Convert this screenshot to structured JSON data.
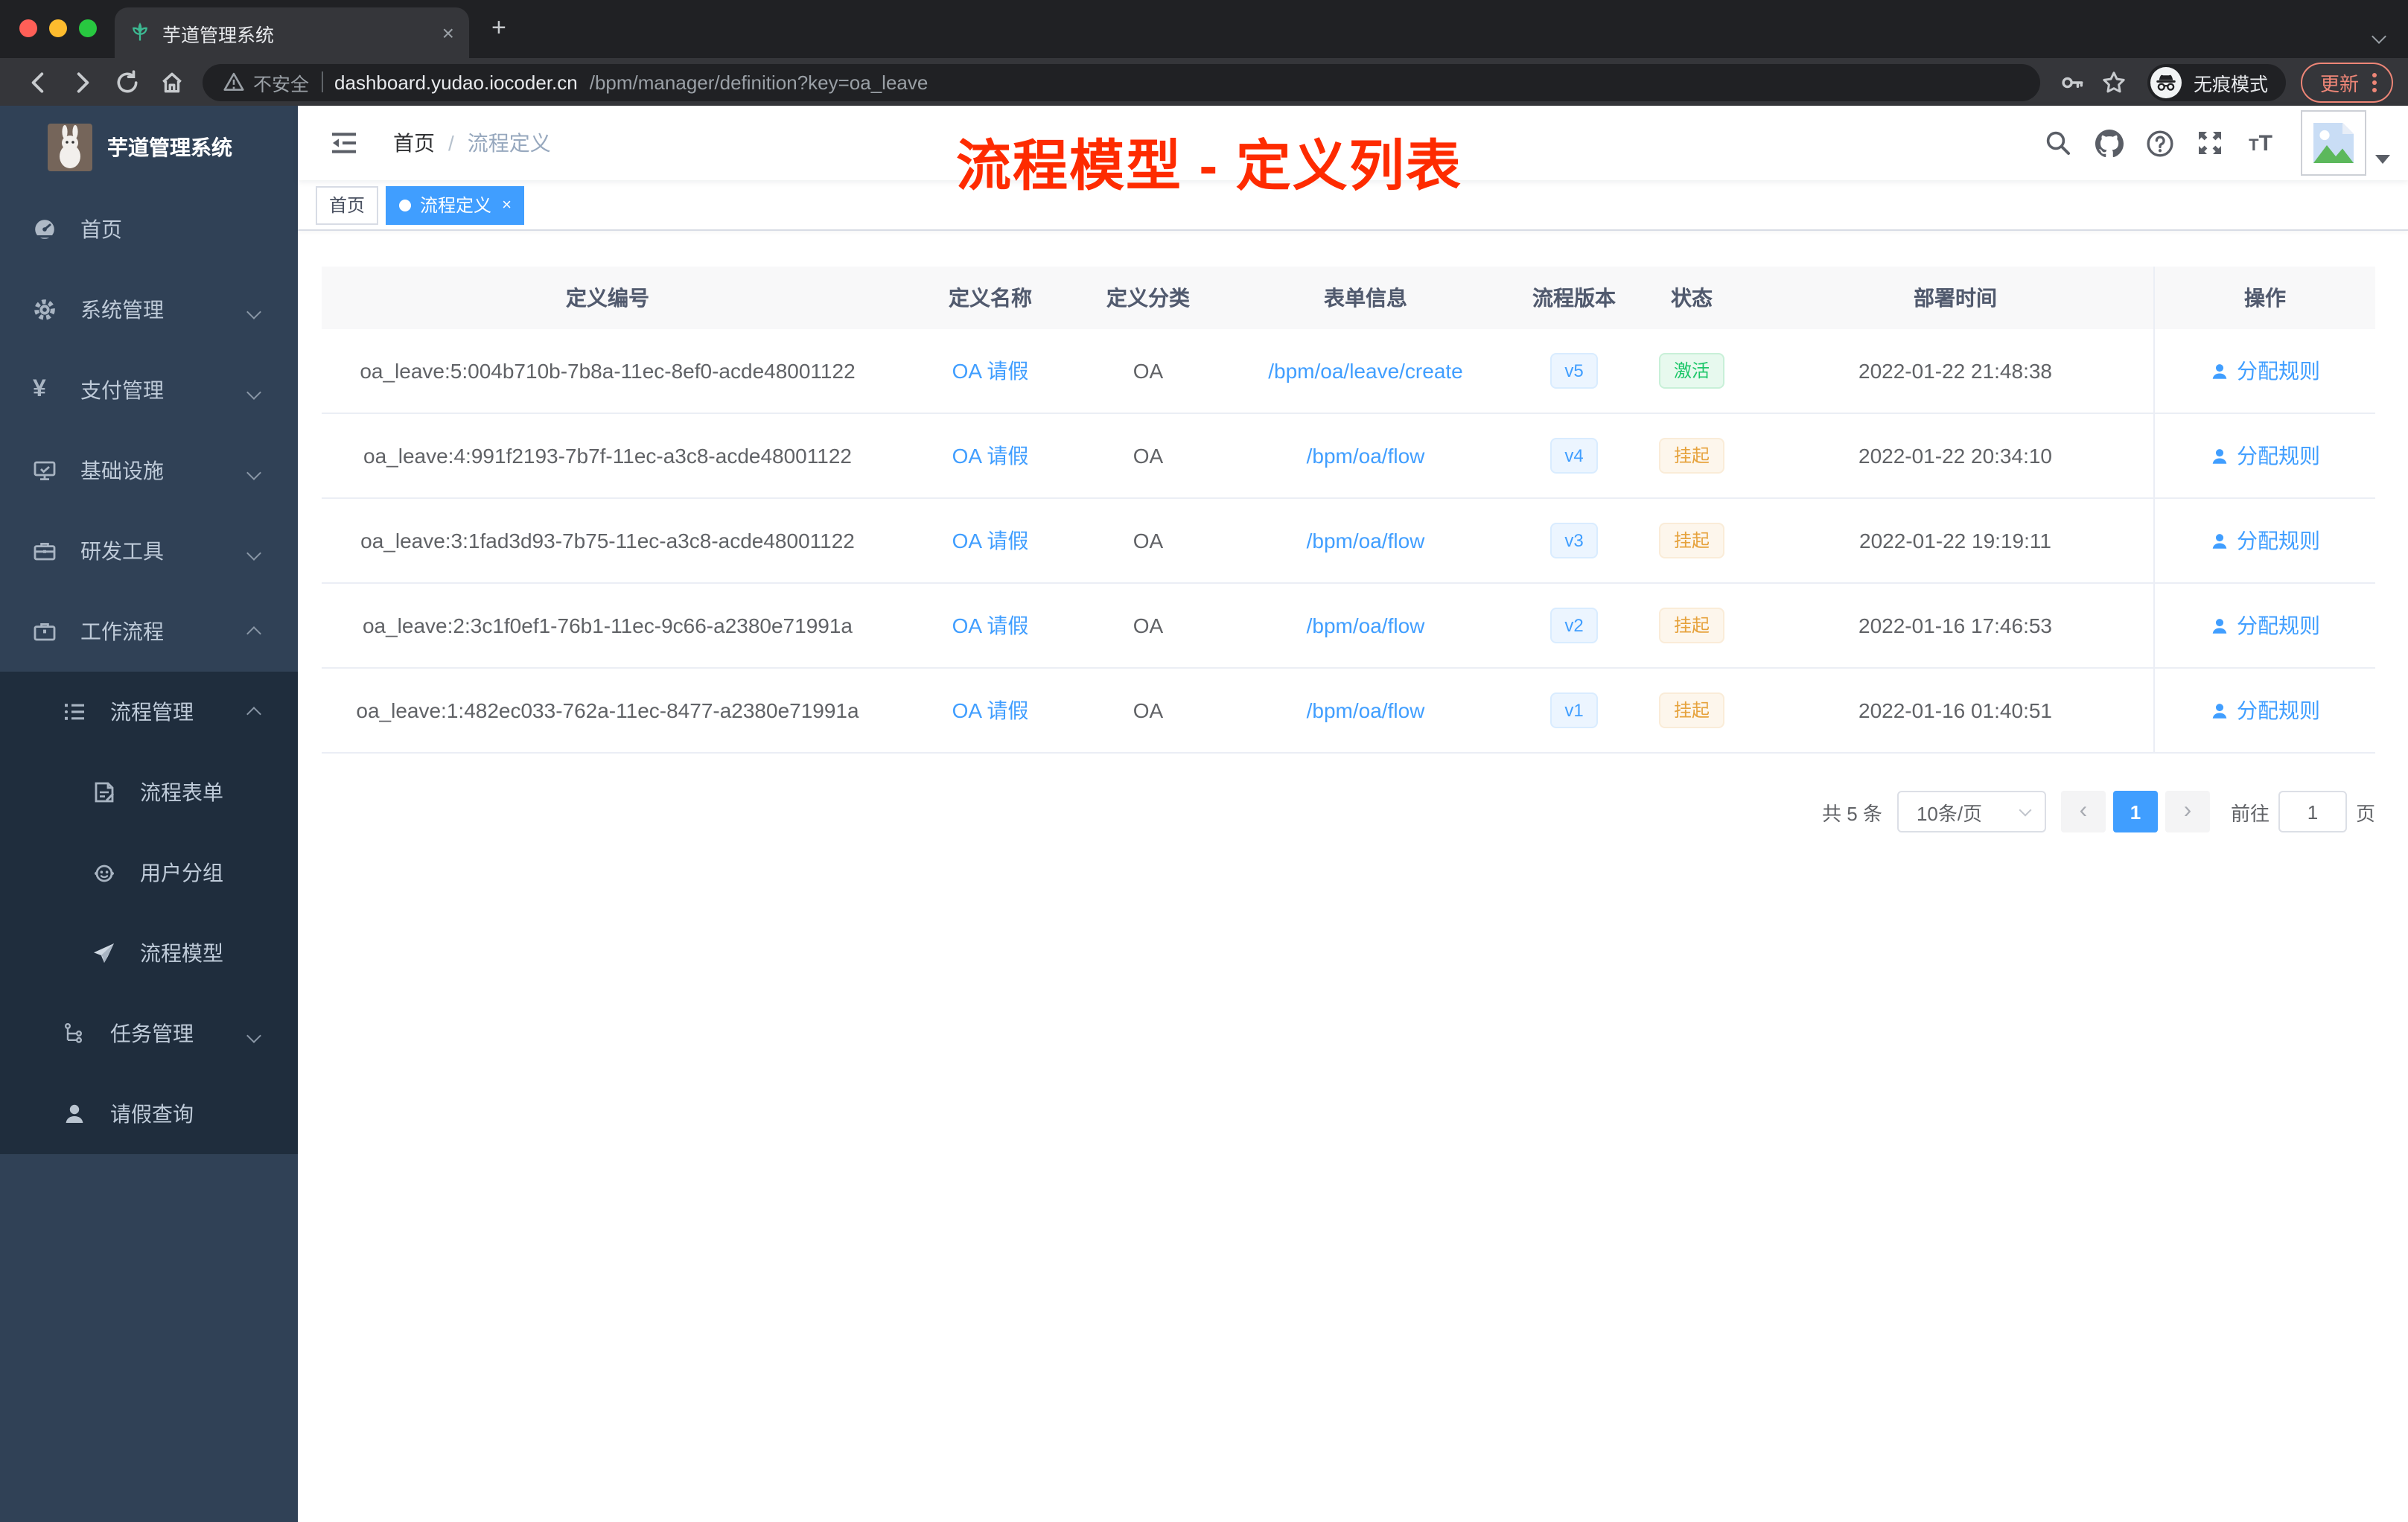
{
  "browser": {
    "tab": {
      "title": "芋道管理系统"
    },
    "address": {
      "warning": "不安全",
      "host": "dashboard.yudao.iocoder.cn",
      "path": "/bpm/manager/definition?key=oa_leave"
    },
    "incognito_label": "无痕模式",
    "update_label": "更新"
  },
  "icons": {
    "tab_close": "×",
    "new_tab": "+",
    "question_mark": "?"
  },
  "sidebar": {
    "app_title": "芋道管理系统",
    "items": [
      {
        "label": "首页",
        "icon": "dashboard-icon"
      },
      {
        "label": "系统管理",
        "icon": "gear-icon",
        "chevron": "down"
      },
      {
        "label": "支付管理",
        "icon": "yen-icon",
        "chevron": "down"
      },
      {
        "label": "基础设施",
        "icon": "monitor-icon",
        "chevron": "down"
      },
      {
        "label": "研发工具",
        "icon": "toolbox-icon",
        "chevron": "down"
      },
      {
        "label": "工作流程",
        "icon": "briefcase-icon",
        "chevron": "up"
      }
    ],
    "submenu": {
      "items": [
        {
          "label": "流程管理",
          "icon": "list-icon",
          "chevron": "up",
          "children": [
            {
              "label": "流程表单",
              "icon": "form-icon"
            },
            {
              "label": "用户分组",
              "icon": "robot-icon"
            },
            {
              "label": "流程模型",
              "icon": "send-icon"
            }
          ]
        },
        {
          "label": "任务管理",
          "icon": "tree-icon",
          "chevron": "down"
        },
        {
          "label": "请假查询",
          "icon": "user-icon"
        }
      ]
    }
  },
  "navbar": {
    "breadcrumb": {
      "home": "首页",
      "separator": "/",
      "current": "流程定义"
    }
  },
  "tags": {
    "home": "首页",
    "active": "流程定义",
    "close": "×"
  },
  "annotation": {
    "title": "流程模型 - 定义列表",
    "color": "#fe2b00"
  },
  "table": {
    "columns": [
      "定义编号",
      "定义名称",
      "定义分类",
      "表单信息",
      "流程版本",
      "状态",
      "部署时间",
      "操作"
    ],
    "action_label": "分配规则",
    "rows": [
      {
        "id": "oa_leave:5:004b710b-7b8a-11ec-8ef0-acde48001122",
        "name": "OA 请假",
        "category": "OA",
        "form": "/bpm/oa/leave/create",
        "version": "v5",
        "status": "激活",
        "status_type": "success",
        "time": "2022-01-22 21:48:38"
      },
      {
        "id": "oa_leave:4:991f2193-7b7f-11ec-a3c8-acde48001122",
        "name": "OA 请假",
        "category": "OA",
        "form": "/bpm/oa/flow",
        "version": "v4",
        "status": "挂起",
        "status_type": "warning",
        "time": "2022-01-22 20:34:10"
      },
      {
        "id": "oa_leave:3:1fad3d93-7b75-11ec-a3c8-acde48001122",
        "name": "OA 请假",
        "category": "OA",
        "form": "/bpm/oa/flow",
        "version": "v3",
        "status": "挂起",
        "status_type": "warning",
        "time": "2022-01-22 19:19:11"
      },
      {
        "id": "oa_leave:2:3c1f0ef1-76b1-11ec-9c66-a2380e71991a",
        "name": "OA 请假",
        "category": "OA",
        "form": "/bpm/oa/flow",
        "version": "v2",
        "status": "挂起",
        "status_type": "warning",
        "time": "2022-01-16 17:46:53"
      },
      {
        "id": "oa_leave:1:482ec033-762a-11ec-8477-a2380e71991a",
        "name": "OA 请假",
        "category": "OA",
        "form": "/bpm/oa/flow",
        "version": "v1",
        "status": "挂起",
        "status_type": "warning",
        "time": "2022-01-16 01:40:51"
      }
    ]
  },
  "pagination": {
    "total": "共 5 条",
    "page_size": "10条/页",
    "current_page": "1",
    "goto": "前往",
    "goto_value": "1",
    "unit": "页"
  },
  "colors": {
    "accent": "#409eff",
    "sidebar": "#304156",
    "submenu": "#1f2d3d",
    "annotation": "#fe2b00",
    "success": "#1cc668",
    "warning": "#e6a23c"
  }
}
